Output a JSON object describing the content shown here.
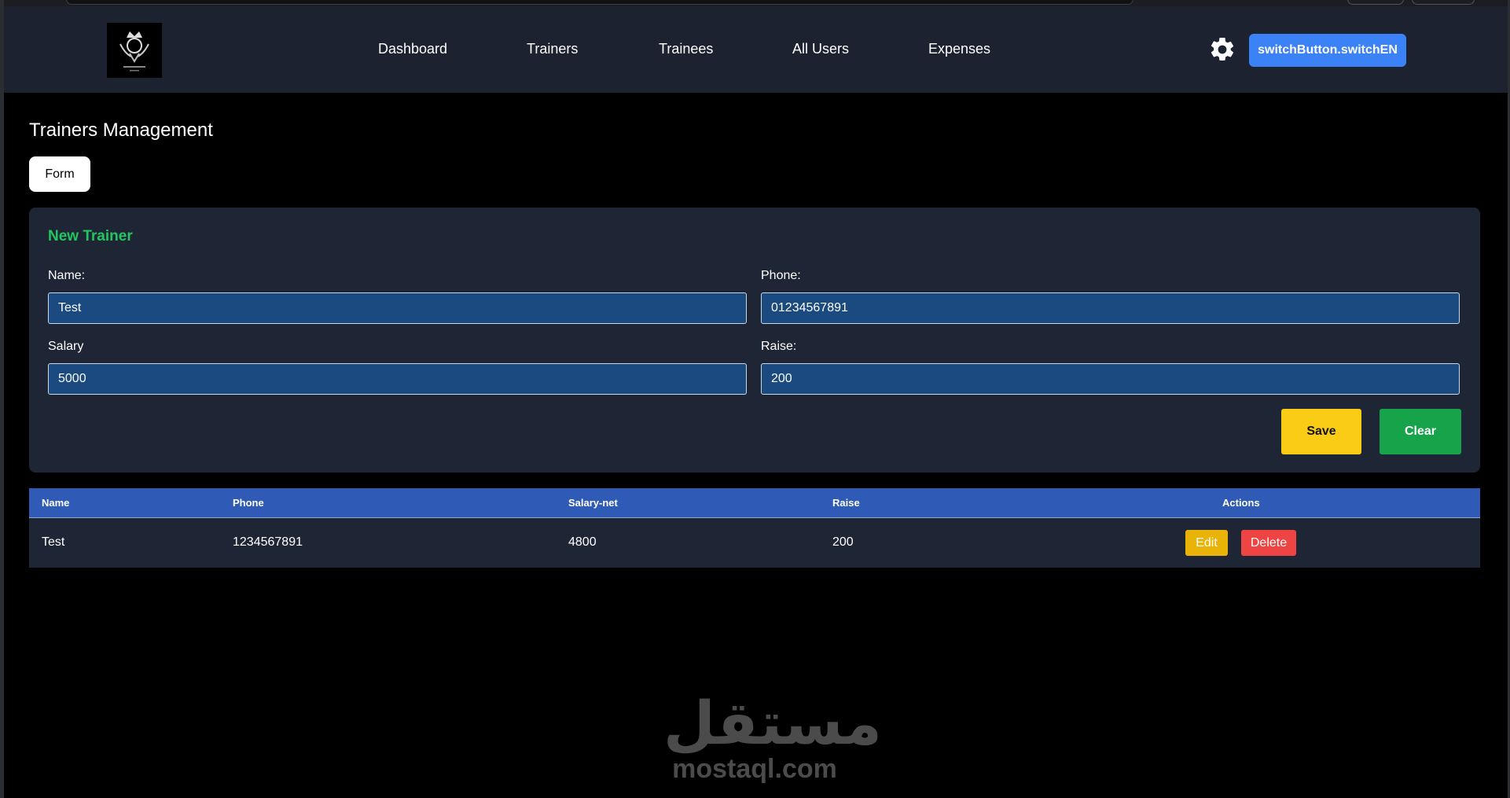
{
  "nav": {
    "links": [
      "Dashboard",
      "Trainers",
      "Trainees",
      "All Users",
      "Expenses"
    ],
    "switch_button": "switchButton.switchEN"
  },
  "page": {
    "title": "Trainers Management",
    "tab": "Form"
  },
  "form": {
    "title": "New Trainer",
    "name_label": "Name:",
    "name_value": "Test",
    "phone_label": "Phone:",
    "phone_value": "01234567891",
    "salary_label": "Salary",
    "salary_value": "5000",
    "raise_label": "Raise:",
    "raise_value": "200",
    "save_label": "Save",
    "clear_label": "Clear"
  },
  "table": {
    "headers": [
      "Name",
      "Phone",
      "Salary-net",
      "Raise",
      "Actions"
    ],
    "rows": [
      {
        "name": "Test",
        "phone": "1234567891",
        "salary_net": "4800",
        "raise": "200",
        "edit": "Edit",
        "delete": "Delete"
      }
    ]
  },
  "watermark": {
    "arabic": "مستقل",
    "latin": "mostaql.com"
  },
  "colors": {
    "navbar": "#1c2230",
    "card": "#1e2636",
    "input": "#1a4a80",
    "accent_green": "#22c55e",
    "switch": "#3b82f6",
    "save": "#facc15",
    "clear": "#16a34a",
    "table_header": "#2f5bb7",
    "edit": "#eab308",
    "delete": "#ef4444"
  }
}
